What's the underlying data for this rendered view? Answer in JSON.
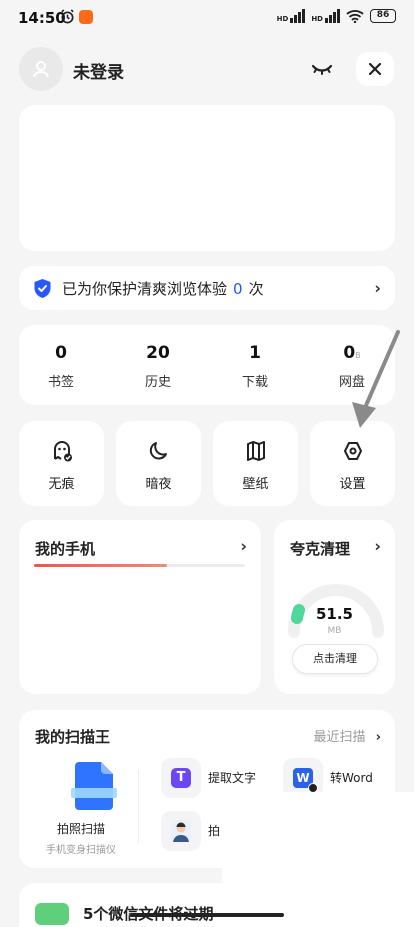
{
  "status": {
    "time": "14:50",
    "battery": "86",
    "signal_labels": [
      "HD",
      "HD"
    ]
  },
  "header": {
    "login_text": "未登录"
  },
  "protect": {
    "text_before": "已为你保护清爽浏览体验",
    "count": "0",
    "text_after": "次"
  },
  "stats": [
    {
      "value": "0",
      "label": "书签"
    },
    {
      "value": "20",
      "label": "历史"
    },
    {
      "value": "1",
      "label": "下载"
    },
    {
      "value": "0",
      "unit": "B",
      "label": "网盘"
    }
  ],
  "tiles": [
    {
      "label": "无痕",
      "icon": "ghost-icon"
    },
    {
      "label": "暗夜",
      "icon": "moon-icon"
    },
    {
      "label": "壁纸",
      "icon": "map-icon"
    },
    {
      "label": "设置",
      "icon": "settings-icon"
    }
  ],
  "phone": {
    "title": "我的手机",
    "usage_fraction": 0.63
  },
  "clean": {
    "title": "夸克清理",
    "value": "51.5",
    "unit": "MB",
    "button": "点击清理"
  },
  "scanner": {
    "title": "我的扫描王",
    "recent": "最近扫描",
    "main_label": "拍照扫描",
    "main_sub": "手机变身扫描仪",
    "tools": [
      {
        "label": "提取文字",
        "icon": "text-extract-icon"
      },
      {
        "label": "转Word",
        "icon": "word-convert-icon"
      },
      {
        "label": "拍",
        "icon": "id-photo-icon"
      }
    ]
  },
  "bottom_card": {
    "text": "5个微信文件将过期"
  },
  "colors": {
    "accent_blue": "#1f55ff",
    "bar_red": "#e8584d",
    "clean_green": "#4fd89a"
  }
}
